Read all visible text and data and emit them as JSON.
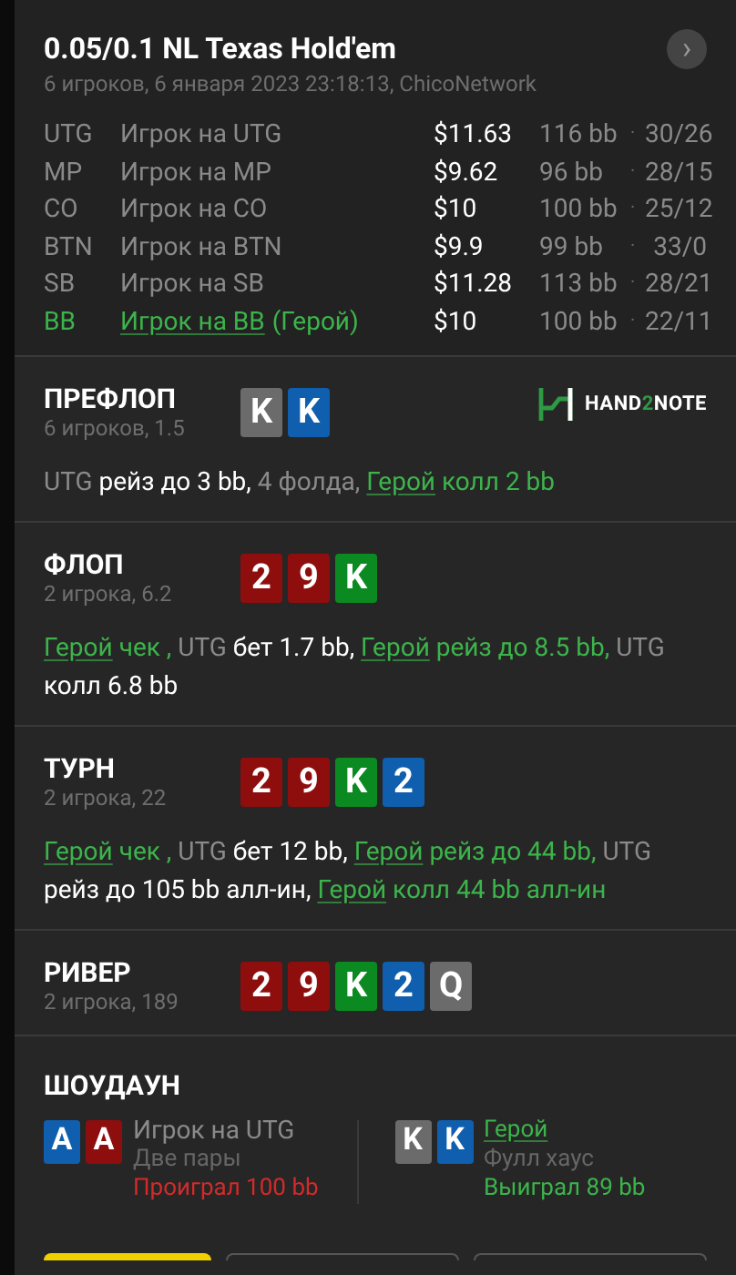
{
  "header": {
    "title": "0.05/0.1 NL Texas Hold'em",
    "subtitle": "6 игроков, 6 января 2023 23:18:13, ChicoNetwork",
    "next_button": "›"
  },
  "players": [
    {
      "position": "UTG",
      "name": "Игрок на UTG",
      "hero": false,
      "stack": "$11.63",
      "bb": "116 bb",
      "separator": "·",
      "stats": "30/26"
    },
    {
      "position": "MP",
      "name": "Игрок на MP",
      "hero": false,
      "stack": "$9.62",
      "bb": "96 bb",
      "separator": "·",
      "stats": "28/15"
    },
    {
      "position": "CO",
      "name": "Игрок на CO",
      "hero": false,
      "stack": "$10",
      "bb": "100 bb",
      "separator": "·",
      "stats": "25/12"
    },
    {
      "position": "BTN",
      "name": "Игрок на BTN",
      "hero": false,
      "stack": "$9.9",
      "bb": "99 bb",
      "separator": "·",
      "stats": "33/0"
    },
    {
      "position": "SB",
      "name": "Игрок на SB",
      "hero": false,
      "stack": "$11.28",
      "bb": "113 bb",
      "separator": "·",
      "stats": "28/21"
    },
    {
      "position": "BB",
      "name": "Игрок на BB",
      "hero": true,
      "hero_label": "(Герой)",
      "stack": "$10",
      "bb": "100 bb",
      "separator": "·",
      "stats": "22/11"
    }
  ],
  "streets": [
    {
      "title": "ПРЕФЛОП",
      "info": "6 игроков, 1.5",
      "logo": {
        "text_main": "HAND",
        "text_accent": "2",
        "text_end": "NOTE"
      },
      "cards": [
        {
          "rank": "K",
          "color": "#6b6b6b"
        },
        {
          "rank": "K",
          "color": "#0f5fae"
        }
      ],
      "actions": [
        {
          "kind": "player",
          "text": "UTG "
        },
        {
          "kind": "action",
          "text": "рейз до 3 bb,"
        },
        {
          "kind": "player",
          "text": " 4 фолда, "
        },
        {
          "kind": "hero",
          "text": "Герой"
        },
        {
          "kind": "hero_action",
          "text": " колл 2 bb"
        }
      ]
    },
    {
      "title": "ФЛОП",
      "info": "2 игрока, 6.2",
      "cards": [
        {
          "rank": "2",
          "color": "#8e0e0e"
        },
        {
          "rank": "9",
          "color": "#8e0e0e"
        },
        {
          "rank": "K",
          "color": "#0b8a22"
        }
      ],
      "actions": [
        {
          "kind": "hero",
          "text": "Герой"
        },
        {
          "kind": "hero_action",
          "text": " чек , "
        },
        {
          "kind": "player",
          "text": "UTG "
        },
        {
          "kind": "action",
          "text": "бет 1.7 bb, "
        },
        {
          "kind": "hero",
          "text": "Герой"
        },
        {
          "kind": "hero_action",
          "text": " рейз до 8.5 bb, "
        },
        {
          "kind": "player",
          "text": "UTG "
        },
        {
          "kind": "action",
          "text": "колл 6.8 bb"
        }
      ]
    },
    {
      "title": "ТУРН",
      "info": "2 игрока, 22",
      "cards": [
        {
          "rank": "2",
          "color": "#8e0e0e"
        },
        {
          "rank": "9",
          "color": "#8e0e0e"
        },
        {
          "rank": "K",
          "color": "#0b8a22"
        },
        {
          "rank": "2",
          "color": "#0f5fae"
        }
      ],
      "actions": [
        {
          "kind": "hero",
          "text": "Герой"
        },
        {
          "kind": "hero_action",
          "text": " чек , "
        },
        {
          "kind": "player",
          "text": "UTG "
        },
        {
          "kind": "action",
          "text": "бет 12 bb, "
        },
        {
          "kind": "hero",
          "text": "Герой"
        },
        {
          "kind": "hero_action",
          "text": " рейз до 44 bb, "
        },
        {
          "kind": "player",
          "text": "UTG "
        },
        {
          "kind": "action",
          "text": "рейз до 105 bb алл-ин, "
        },
        {
          "kind": "hero",
          "text": "Герой"
        },
        {
          "kind": "hero_action",
          "text": " колл 44 bb алл-ин"
        }
      ]
    },
    {
      "title": "РИВЕР",
      "info": "2 игрока, 189",
      "cards": [
        {
          "rank": "2",
          "color": "#8e0e0e"
        },
        {
          "rank": "9",
          "color": "#8e0e0e"
        },
        {
          "rank": "K",
          "color": "#0b8a22"
        },
        {
          "rank": "2",
          "color": "#0f5fae"
        },
        {
          "rank": "Q",
          "color": "#6b6b6b"
        }
      ]
    }
  ],
  "showdown": {
    "title": "ШОУДАУН",
    "hands": [
      {
        "cards": [
          {
            "rank": "A",
            "color": "#0f5fae"
          },
          {
            "rank": "A",
            "color": "#8e0e0e"
          }
        ],
        "name": "Игрок на UTG",
        "hero": false,
        "combo": "Две пары",
        "result": "Проиграл 100 bb",
        "won": false
      },
      {
        "cards": [
          {
            "rank": "K",
            "color": "#6b6b6b"
          },
          {
            "rank": "K",
            "color": "#0f5fae"
          }
        ],
        "name": "Герой",
        "hero": true,
        "combo": "Фулл хаус",
        "result": "Выиграл 89 bb",
        "won": true
      }
    ]
  },
  "bottom_buttons": [
    {
      "kind": "primary"
    },
    {
      "kind": "outline"
    },
    {
      "kind": "outline"
    }
  ]
}
